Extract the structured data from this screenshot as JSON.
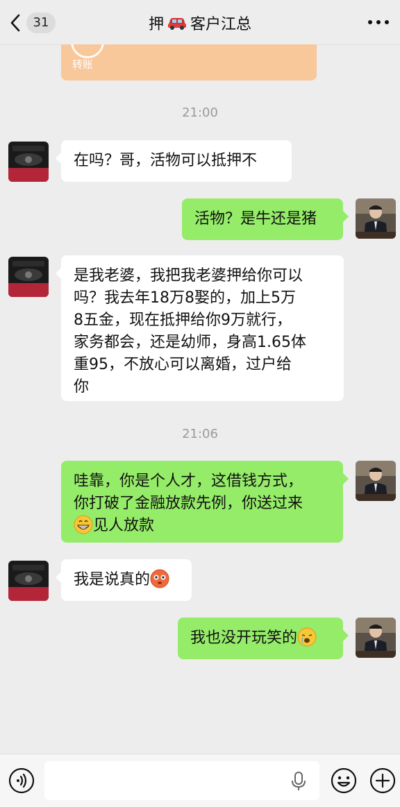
{
  "header": {
    "back_count": "31",
    "title_prefix": "押",
    "title_suffix": "客户江总"
  },
  "transfer": {
    "label": "转账"
  },
  "messages": [
    {
      "type": "time",
      "text": "21:00"
    },
    {
      "type": "received",
      "text": "在吗？哥，活物可以抵押不"
    },
    {
      "type": "sent",
      "text": "活物？是牛还是猪"
    },
    {
      "type": "received",
      "lines": [
        "是我老婆，我把我老婆押给你可以",
        "吗？我去年18万8娶的，加上5万",
        "8五金，现在抵押给你9万就行，",
        "家务都会，还是幼师，身高1.65体",
        "重95，不放心可以离婚，过户给",
        "你"
      ]
    },
    {
      "type": "time",
      "text": "21:06"
    },
    {
      "type": "sent",
      "lines": [
        "哇靠，你是个人才，这借钱方式，",
        "你打破了金融放款先例，你送过来"
      ],
      "last_line": "见人放款",
      "emoji": "grin-emoji"
    },
    {
      "type": "received",
      "text": "我是说真的",
      "emoji": "flushed-emoji"
    },
    {
      "type": "sent",
      "text": "我也没开玩笑的",
      "emoji": "crying-emoji"
    }
  ],
  "input": {
    "placeholder": ""
  },
  "icons": {
    "back": "chevron-left-icon",
    "car": "red-car-icon",
    "more": "more-dots-icon",
    "voice": "voice-icon",
    "mic": "mic-icon",
    "emoji": "smiley-icon",
    "plus": "plus-icon"
  },
  "colors": {
    "sent_bubble": "#95ec69",
    "received_bubble": "#ffffff",
    "background": "#ededed",
    "transfer_card": "#f8c79a"
  }
}
